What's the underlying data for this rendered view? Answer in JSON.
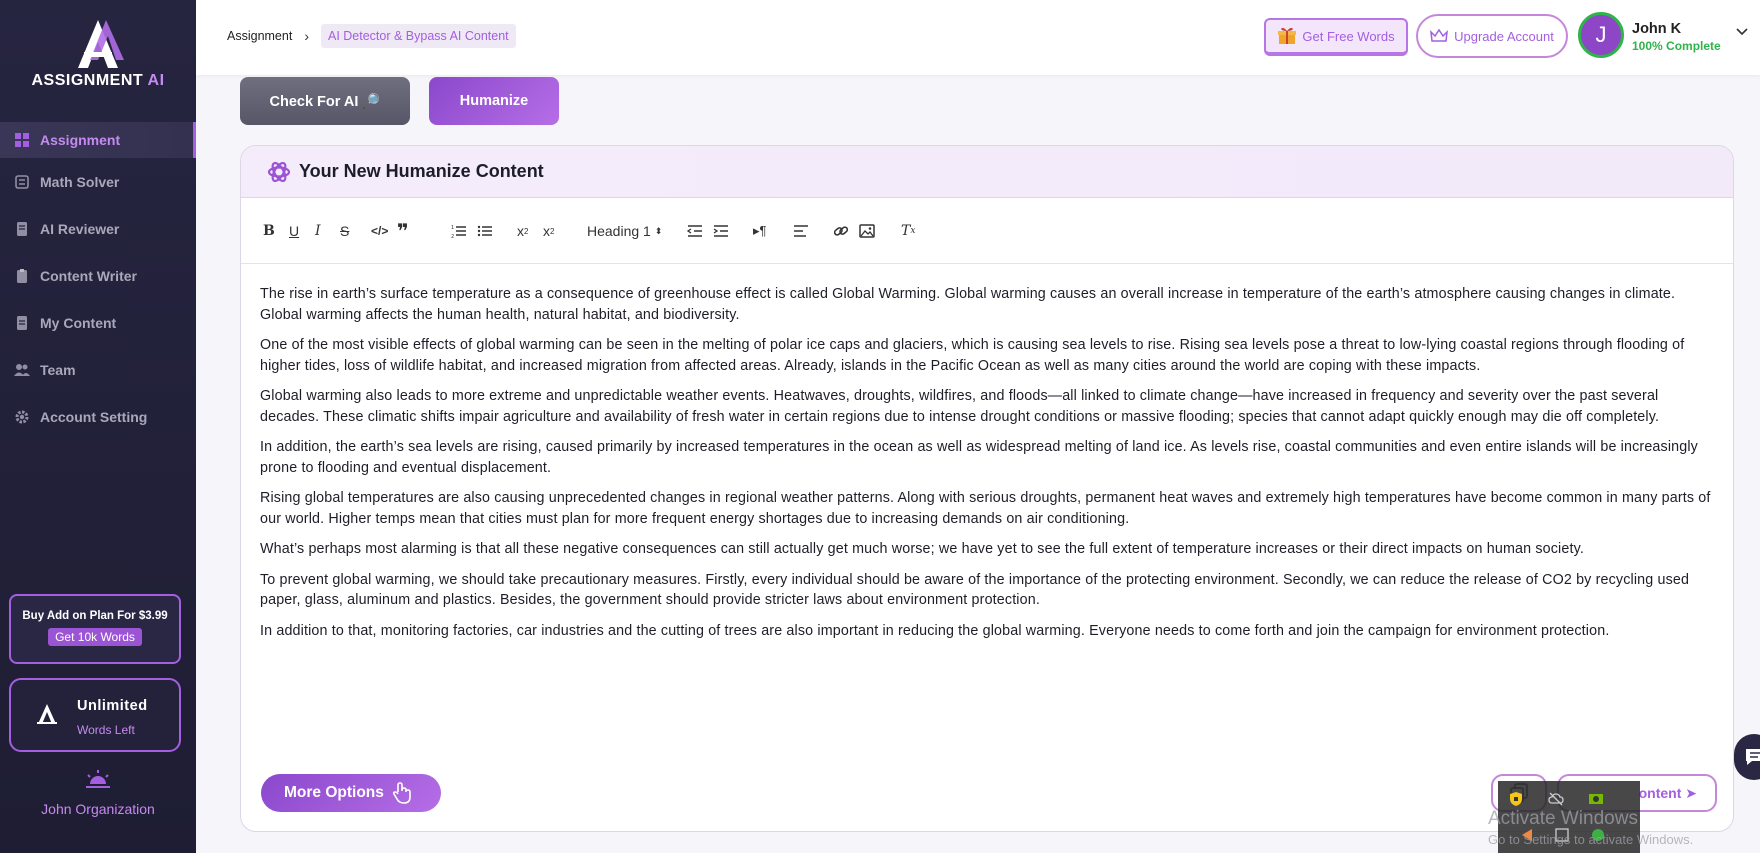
{
  "brand": {
    "name": "ASSIGNMENT",
    "suffix": "AI"
  },
  "sidebar": {
    "items": [
      {
        "label": "Assignment",
        "icon": "dashboard-icon",
        "active": true
      },
      {
        "label": "Math Solver",
        "icon": "math-icon"
      },
      {
        "label": "AI Reviewer",
        "icon": "reviewer-icon"
      },
      {
        "label": "Content Writer",
        "icon": "clipboard-icon"
      },
      {
        "label": "My Content",
        "icon": "document-icon"
      },
      {
        "label": "Team",
        "icon": "team-icon"
      },
      {
        "label": "Account Setting",
        "icon": "gear-icon"
      }
    ],
    "promo": {
      "text": "Buy Add on Plan For $3.99",
      "button": "Get 10k Words"
    },
    "unlimited": {
      "title": "Unlimited",
      "subtitle": "Words Left"
    },
    "organization": "John Organization"
  },
  "header": {
    "breadcrumb": [
      "Assignment",
      "AI Detector & Bypass AI Content"
    ],
    "free_words": "Get Free Words",
    "upgrade": "Upgrade Account",
    "user": {
      "initial": "J",
      "name": "John K",
      "status": "100% Complete"
    }
  },
  "tabs": {
    "check": "Check For AI 🔎",
    "humanize": "Humanize"
  },
  "editor": {
    "title": "Your New Humanize Content",
    "heading_select": "Heading 1",
    "paragraphs": [
      "The rise in earth’s surface temperature as a consequence of greenhouse effect is called Global Warming. Global warming causes an overall increase in temperature of the earth’s atmosphere causing changes in climate. Global warming affects the human health, natural habitat, and biodiversity.",
      "One of the most visible effects of global warming can be seen in the melting of polar ice caps and glaciers, which is causing sea levels to rise. Rising sea levels pose a threat to low-lying coastal regions through flooding of higher tides, loss of wildlife habitat, and increased migration from affected areas. Already, islands in the Pacific Ocean as well as many cities around the world are coping with these impacts.",
      "Global warming also leads to more extreme and unpredictable weather events. Heatwaves, droughts, wildfires, and floods—all linked to climate change—have increased in frequency and severity over the past several decades. These climatic shifts impair agriculture and availability of fresh water in certain regions due to intense drought conditions or massive flooding; species that cannot adapt quickly enough may die off completely.",
      "In addition, the earth’s sea levels are rising, caused primarily by increased temperatures in the ocean as well as widespread melting of land ice. As levels rise, coastal communities and even entire islands will be increasingly prone to flooding and eventual displacement.",
      "Rising global temperatures are also causing unprecedented changes in regional weather patterns. Along with serious droughts, permanent heat waves and extremely high temperatures have become common in many parts of our world. Higher temps mean that cities must plan for more frequent energy shortages due to increasing demands on air conditioning.",
      "What’s perhaps most alarming is that all these negative consequences can still actually get much worse; we have yet to see the full extent of temperature increases or their direct impacts on human society.",
      "To prevent global warming, we should take precautionary measures. Firstly, every individual should be aware of the importance of the protecting environment. Secondly, we can reduce the release of CO2 by recycling used paper, glass, aluminum and plastics. Besides, the government should provide stricter laws about environment protection.",
      "In addition to that, monitoring factories, car industries and the cutting of trees are also important in reducing the global warming. Everyone needs to come forth and join the campaign for environment protection."
    ],
    "more_options": "More Options",
    "save_label": "ontent ➤"
  },
  "windows": {
    "activate": "Activate Windows",
    "goto": "Go to Settings to activate Windows."
  },
  "colors": {
    "accent": "#a45ee0",
    "sidebar": "#262540",
    "success": "#2fb44a"
  }
}
